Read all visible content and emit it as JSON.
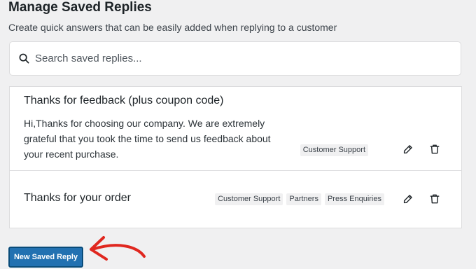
{
  "header": {
    "title": "Manage Saved Replies",
    "subtitle": "Create quick answers that can be easily added when replying to a customer"
  },
  "search": {
    "placeholder": "Search saved replies...",
    "value": ""
  },
  "replies": [
    {
      "title": "Thanks for feedback (plus coupon code)",
      "body": "Hi,Thanks for choosing our company. We are extremely grateful that you took the time to send us feedback about your recent purchase.",
      "tags": [
        "Customer Support"
      ]
    },
    {
      "title": "Thanks for your order",
      "body": "",
      "tags": [
        "Customer Support",
        "Partners",
        "Press Enquiries"
      ]
    }
  ],
  "actions": {
    "new_reply_label": "New Saved Reply"
  },
  "colors": {
    "primary_button": "#2271b1",
    "annotation_arrow": "#e0271f",
    "background": "#f0f0f1"
  },
  "icons": {
    "search": "search-icon",
    "edit": "pencil-icon",
    "delete": "trash-icon",
    "annotation": "arrow-icon"
  }
}
